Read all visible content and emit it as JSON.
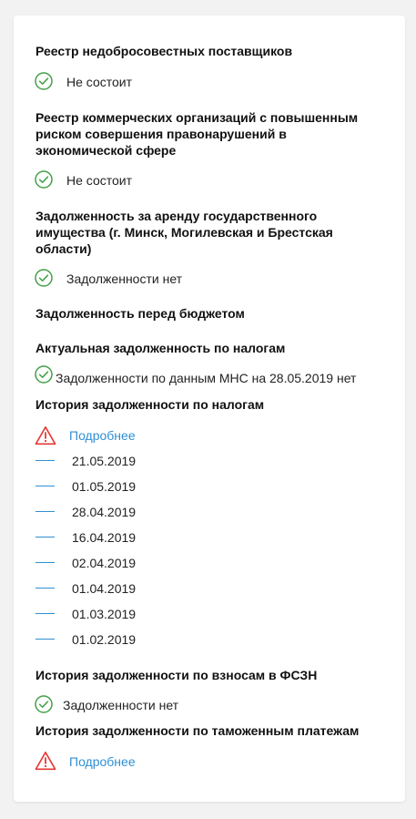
{
  "colors": {
    "check": "#43a047",
    "warning": "#e53935",
    "link": "#2f8fd4",
    "dash": "#2f8fd4"
  },
  "sections": {
    "unfair_suppliers": {
      "title": "Реестр недобросовестных поставщиков",
      "status": "Не состоит",
      "icon": "check-circle-icon"
    },
    "high_risk_orgs": {
      "title": "Реестр коммерческих организаций с повышенным риском совершения правонарушений в экономической сфере",
      "status": "Не состоит",
      "icon": "check-circle-icon"
    },
    "property_rent_debt": {
      "title": "Задолженность за аренду государственного имущества (г. Минск, Могилевская и Брестская области)",
      "status": "Задолженности нет",
      "icon": "check-circle-icon"
    },
    "budget_debt": {
      "title": "Задолженность перед бюджетом"
    },
    "current_tax_debt": {
      "title": "Актуальная задолженность по налогам",
      "status": "Задолженности по данным МНС на 28.05.2019 нет",
      "icon": "check-circle-icon"
    },
    "tax_debt_history": {
      "title": "История задолженности по налогам",
      "link": "Подробнее",
      "icon": "warning-icon",
      "dates": [
        "21.05.2019",
        "01.05.2019",
        "28.04.2019",
        "16.04.2019",
        "02.04.2019",
        "01.04.2019",
        "01.03.2019",
        "01.02.2019"
      ]
    },
    "fszn_debt_history": {
      "title": "История задолженности по взносам в ФСЗН",
      "status": "Задолженности нет",
      "icon": "check-circle-icon"
    },
    "customs_debt_history": {
      "title": "История задолженности по таможенным платежам",
      "link": "Подробнее",
      "icon": "warning-icon"
    }
  }
}
